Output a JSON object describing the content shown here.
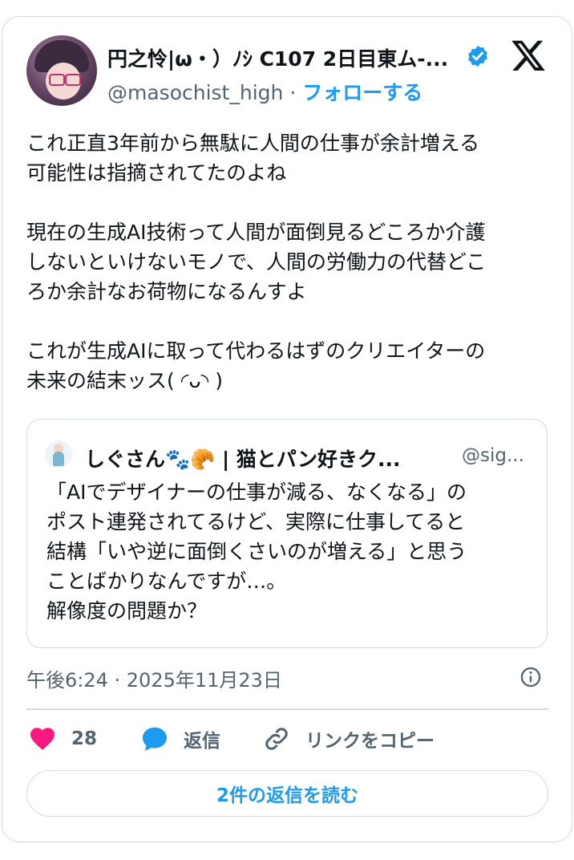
{
  "author": {
    "display_name": "円之怜|ω・）ﾉｼ C107 2日目東ム-...",
    "handle": "@masochist_high",
    "separator": "·",
    "follow_label": "フォローする",
    "verified": true
  },
  "tweet": {
    "paragraphs": [
      "これ正直3年前から無駄に人間の仕事が余計増える\n可能性は指摘されてたのよね",
      "現在の生成AI技術って人間が面倒見るどころか介護\nしないといけないモノで、人間の労働力の代替どこ\nろか余計なお荷物になるんすよ",
      "これが生成AIに取って代わるはずのクリエイターの\n未来の結末ッス( ◜ᴗ◝ )"
    ]
  },
  "quoted": {
    "display_name": "しぐさん🐾🥐 | 猫とパン好きク...",
    "handle": "@sig...",
    "text": "「AIでデザイナーの仕事が減る、なくなる」の\nポスト連発されてるけど、実際に仕事してると\n結構「いや逆に面倒くさいのが増える」と思う\nことばかりなんですが…。\n解像度の問題か？"
  },
  "timestamp": "午後6:24 · 2025年11月23日",
  "actions": {
    "like_count": "28",
    "reply_label": "返信",
    "copy_link_label": "リンクをコピー"
  },
  "read_replies_label": "2件の返信を読む",
  "colors": {
    "accent": "#1d9bf0",
    "like": "#f91880",
    "text": "#0f1419",
    "secondary": "#536471",
    "border": "#cfd9de"
  },
  "icons": [
    "verified-badge-icon",
    "x-logo-icon",
    "info-icon",
    "heart-icon",
    "reply-bubble-icon",
    "link-icon"
  ]
}
